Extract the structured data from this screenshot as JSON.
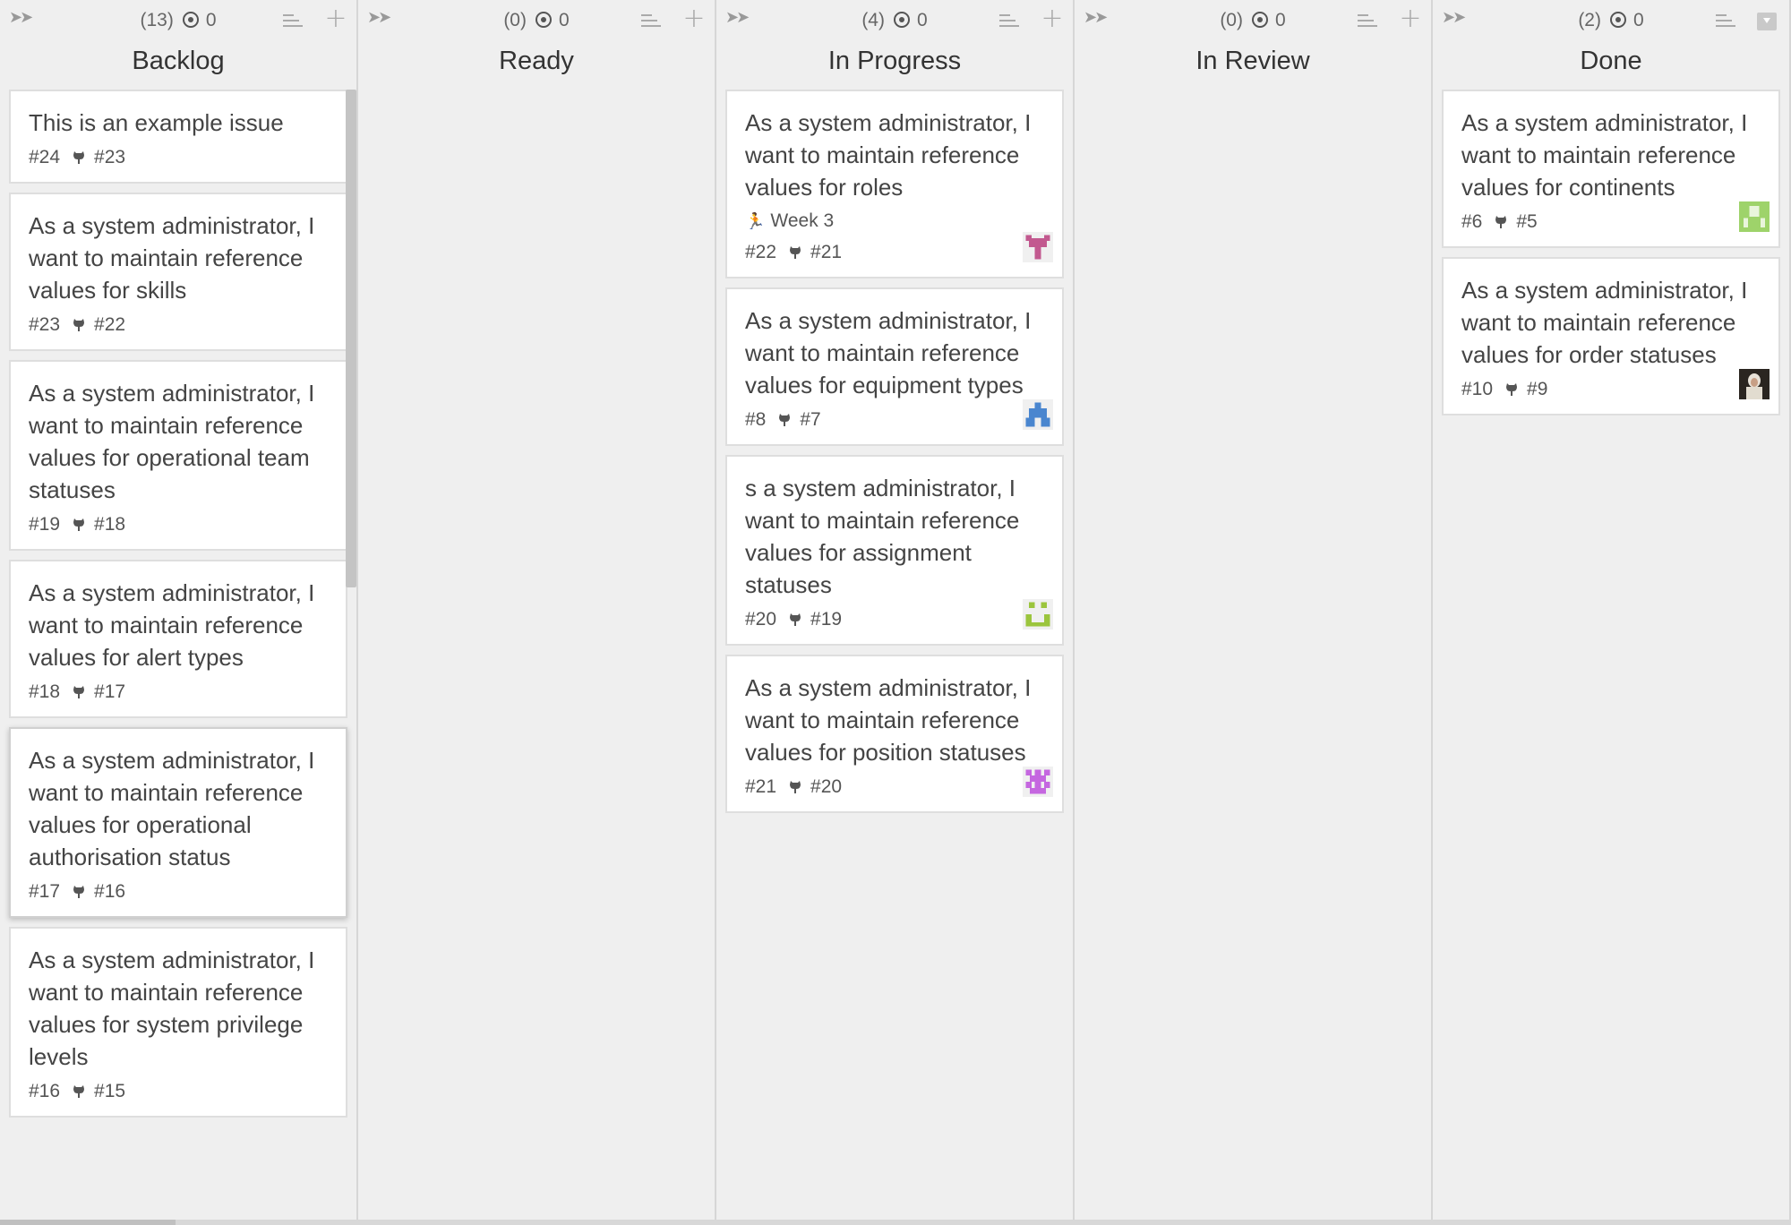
{
  "columns": [
    {
      "title": "Backlog",
      "count": "(13)",
      "pipeline_icon": "target-icon",
      "pipeline_value": "0",
      "cards": [
        {
          "title": "This is an example issue",
          "number": "#24",
          "ref": "#23"
        },
        {
          "title": "As a system administrator, I want to maintain reference values for skills",
          "number": "#23",
          "ref": "#22"
        },
        {
          "title": "As a system administrator, I want to maintain reference values for operational team statuses",
          "number": "#19",
          "ref": "#18"
        },
        {
          "title": "As a system administrator, I want to maintain reference values for alert types",
          "number": "#18",
          "ref": "#17"
        },
        {
          "title": "As a system administrator, I want to maintain reference values for operational authorisation status",
          "number": "#17",
          "ref": "#16"
        },
        {
          "title": "As a system administrator, I want to maintain reference values for system privilege levels",
          "number": "#16",
          "ref": "#15"
        }
      ]
    },
    {
      "title": "Ready",
      "count": "(0)",
      "pipeline_icon": "target-icon",
      "pipeline_value": "0",
      "cards": []
    },
    {
      "title": "In Progress",
      "count": "(4)",
      "pipeline_icon": "target-icon",
      "pipeline_value": "0",
      "cards": [
        {
          "title": "As a system administrator, I want to maintain reference values for roles",
          "milestone": "Week 3",
          "number": "#22",
          "ref": "#21",
          "avatar": "identicon-pink"
        },
        {
          "title": "As a system administrator, I want to maintain reference values for equipment types",
          "number": "#8",
          "ref": "#7",
          "avatar": "identicon-blue"
        },
        {
          "title": "s a system administrator, I want to maintain reference values for assignment statuses",
          "number": "#20",
          "ref": "#19",
          "avatar": "identicon-green"
        },
        {
          "title": "As a system administrator, I want to maintain reference values for position statuses",
          "number": "#21",
          "ref": "#20",
          "avatar": "identicon-purple"
        }
      ]
    },
    {
      "title": "In Review",
      "count": "(0)",
      "pipeline_icon": "target-icon",
      "pipeline_value": "0",
      "cards": []
    },
    {
      "title": "Done",
      "count": "(2)",
      "pipeline_icon": "target-icon",
      "pipeline_value": "0",
      "cards": [
        {
          "title": "As a system administrator, I want to maintain reference values for continents",
          "number": "#6",
          "ref": "#5",
          "avatar": "identicon-lightgreen"
        },
        {
          "title": "As a system administrator, I want to maintain reference values for order statuses",
          "number": "#10",
          "ref": "#9",
          "avatar": "photo-avatar"
        }
      ]
    }
  ],
  "icons": {
    "collapse": "collapse-arrows-icon",
    "sort": "sort-icon",
    "add": "plus-icon",
    "archive": "archive-icon",
    "issue_link": "github-octocat-icon",
    "milestone": "milestone-icon"
  },
  "colors": {
    "background": "#eeeeee",
    "card": "#ffffff",
    "identicon-pink": "#c2598f",
    "identicon-blue": "#4a86cf",
    "identicon-green": "#9bc53d",
    "identicon-purple": "#c567e0",
    "identicon-lightgreen": "#9ed36a"
  }
}
